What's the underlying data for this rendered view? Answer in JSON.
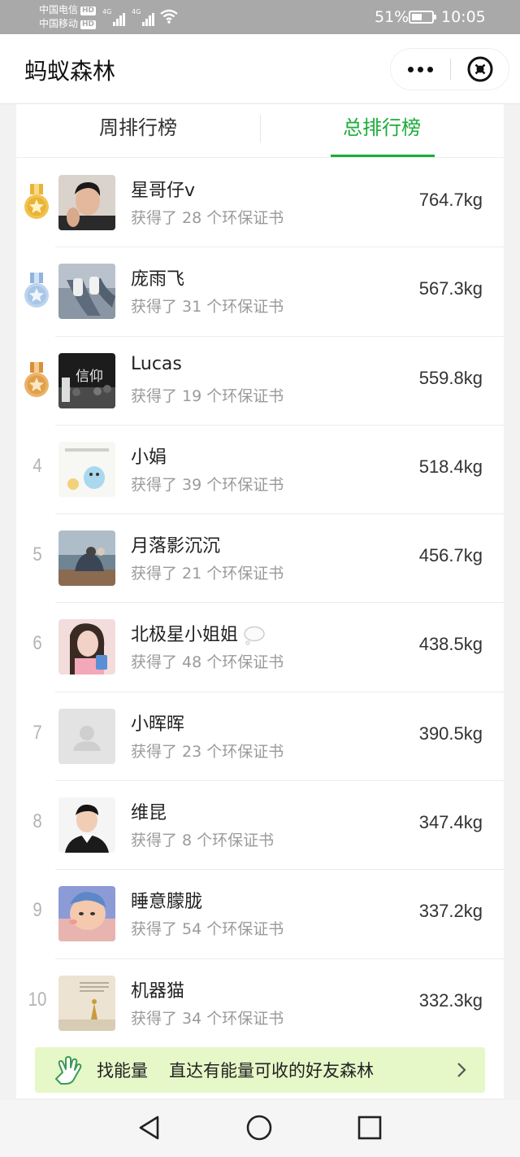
{
  "status_bar": {
    "carrier_1": "中国电信",
    "carrier_2": "中国移动",
    "hd_badge": "HD",
    "network": "4G",
    "battery": "51%",
    "battery_level": 0.51,
    "time": "10:05"
  },
  "titlebar": {
    "title": "蚂蚁森林",
    "more_icon": "more-dots-icon",
    "close_icon": "close-circle-icon"
  },
  "tabs": [
    {
      "label": "周排行榜",
      "active": false
    },
    {
      "label": "总排行榜",
      "active": true
    }
  ],
  "ranking": [
    {
      "rank": "1",
      "medal": "gold",
      "name": "星哥仔v",
      "certs": "获得了 28 个环保证书",
      "amount": "764.7kg"
    },
    {
      "rank": "2",
      "medal": "silver",
      "name": "庞雨飞",
      "certs": "获得了 31 个环保证书",
      "amount": "567.3kg"
    },
    {
      "rank": "3",
      "medal": "bronze",
      "name": "Lucas",
      "certs": "获得了 19 个环保证书",
      "amount": "559.8kg",
      "avatar_text": "信仰"
    },
    {
      "rank": "4",
      "medal": "",
      "name": "小娟",
      "certs": "获得了 39 个环保证书",
      "amount": "518.4kg"
    },
    {
      "rank": "5",
      "medal": "",
      "name": "月落影沉沉",
      "certs": "获得了 21 个环保证书",
      "amount": "456.7kg"
    },
    {
      "rank": "6",
      "medal": "",
      "name": "北极星小姐姐",
      "certs": "获得了 48 个环保证书",
      "amount": "438.5kg",
      "name_icon": "speech-bubble-icon"
    },
    {
      "rank": "7",
      "medal": "",
      "name": "小晖晖",
      "certs": "获得了 23 个环保证书",
      "amount": "390.5kg"
    },
    {
      "rank": "8",
      "medal": "",
      "name": "维昆",
      "certs": "获得了 8 个环保证书",
      "amount": "347.4kg"
    },
    {
      "rank": "9",
      "medal": "",
      "name": "睡意朦胧",
      "certs": "获得了 54 个环保证书",
      "amount": "337.2kg"
    },
    {
      "rank": "10",
      "medal": "",
      "name": "机器猫",
      "certs": "获得了 34 个环保证书",
      "amount": "332.3kg"
    }
  ],
  "energy_banner": {
    "title": "找能量",
    "description": "直达有能量可收的好友森林",
    "icon": "hand-icon"
  },
  "navbar": {
    "back_icon": "back-triangle-icon",
    "home_icon": "home-circle-icon",
    "recents_icon": "recents-square-icon"
  },
  "colors": {
    "accent": "#1aad3a",
    "banner_bg": "#e6f7c8",
    "gold": "#e9b33a",
    "silver": "#a8c6e6",
    "bronze": "#e0a04a"
  }
}
